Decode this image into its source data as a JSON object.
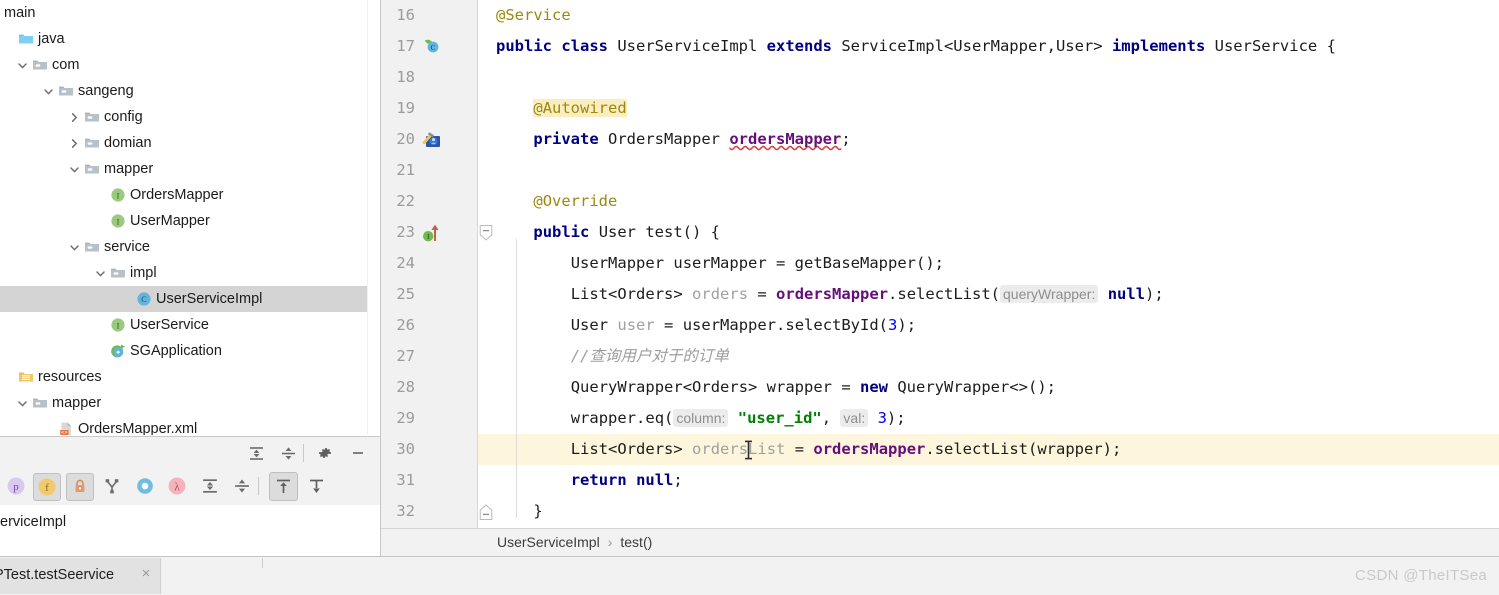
{
  "project_tree": {
    "rows": [
      {
        "label": "main",
        "indent": -14,
        "twisty": "",
        "icon": "none",
        "selected": false
      },
      {
        "label": "java",
        "indent": 0,
        "twisty": "",
        "icon": "source-folder-blue",
        "selected": false
      },
      {
        "label": "com",
        "indent": 14,
        "twisty": "down",
        "icon": "folder",
        "selected": false
      },
      {
        "label": "sangeng",
        "indent": 40,
        "twisty": "down",
        "icon": "folder",
        "selected": false
      },
      {
        "label": "config",
        "indent": 66,
        "twisty": "right",
        "icon": "folder",
        "selected": false
      },
      {
        "label": "domian",
        "indent": 66,
        "twisty": "right",
        "icon": "folder",
        "selected": false
      },
      {
        "label": "mapper",
        "indent": 66,
        "twisty": "down",
        "icon": "folder",
        "selected": false
      },
      {
        "label": "OrdersMapper",
        "indent": 92,
        "twisty": "",
        "icon": "interface",
        "selected": false
      },
      {
        "label": "UserMapper",
        "indent": 92,
        "twisty": "",
        "icon": "interface",
        "selected": false
      },
      {
        "label": "service",
        "indent": 66,
        "twisty": "down",
        "icon": "folder",
        "selected": false
      },
      {
        "label": "impl",
        "indent": 92,
        "twisty": "down",
        "icon": "folder",
        "selected": false
      },
      {
        "label": "UserServiceImpl",
        "indent": 118,
        "twisty": "",
        "icon": "class",
        "selected": true
      },
      {
        "label": "UserService",
        "indent": 92,
        "twisty": "",
        "icon": "interface",
        "selected": false
      },
      {
        "label": "SGApplication",
        "indent": 92,
        "twisty": "",
        "icon": "spring-boot-app",
        "selected": false
      },
      {
        "label": "resources",
        "indent": 0,
        "twisty": "",
        "icon": "resources-folder",
        "selected": false
      },
      {
        "label": "mapper",
        "indent": 14,
        "twisty": "down",
        "icon": "folder",
        "selected": false
      },
      {
        "label": "OrdersMapper.xml",
        "indent": 40,
        "twisty": "",
        "icon": "xml-file",
        "selected": false
      }
    ]
  },
  "panel_toolbar_top": {
    "buttons": [
      {
        "name": "expand-all-icon",
        "title": "Expand All"
      },
      {
        "name": "collapse-all-icon",
        "title": "Collapse All"
      },
      {
        "name": "gear-icon",
        "title": "Settings"
      },
      {
        "name": "minimize-icon",
        "title": "Hide"
      }
    ]
  },
  "panel_toolbar_filters": {
    "buttons": [
      {
        "name": "filter-package-private-icon",
        "letter": "p",
        "color": "#d7c6ef",
        "textcolor": "#6a4ca8",
        "active": false
      },
      {
        "name": "filter-fields-icon",
        "letter": "f",
        "color": "#f2c96b",
        "textcolor": "#8a6a16",
        "active": true
      },
      {
        "name": "filter-private-lock-icon",
        "letter": "lock",
        "color": "#e39a6b",
        "textcolor": "#a8541b",
        "active": true
      },
      {
        "name": "show-hierarchy-icon",
        "letter": "",
        "color": "#777777",
        "textcolor": "#777777",
        "active": false
      },
      {
        "name": "filter-non-null-icon",
        "letter": "O",
        "color": "#72bce0",
        "textcolor": "#72bce0",
        "active": false
      },
      {
        "name": "filter-lambda-icon",
        "letter": "λ",
        "color": "#f2b3bd",
        "textcolor": "#b84b62",
        "active": false
      },
      {
        "name": "expand-all-icon",
        "letter": "",
        "color": "#6b6b6b",
        "textcolor": "#6b6b6b",
        "active": false
      },
      {
        "name": "collapse-all-icon",
        "letter": "",
        "color": "#6b6b6b",
        "textcolor": "#6b6b6b",
        "active": false
      },
      {
        "name": "scroll-from-source-icon",
        "letter": "",
        "color": "#6b6b6b",
        "textcolor": "#6b6b6b",
        "active": true
      },
      {
        "name": "scroll-to-source-icon",
        "letter": "",
        "color": "#6b6b6b",
        "textcolor": "#6b6b6b",
        "active": false
      }
    ]
  },
  "run_output": {
    "text": "erviceImpl"
  },
  "bottom_bar": {
    "tab_label": "PTest.testSeervice",
    "tab_close": "×",
    "watermark": "CSDN @TheITSea"
  },
  "breadcrumb": {
    "class": "UserServiceImpl",
    "separator": "›",
    "method": "test()"
  },
  "editor": {
    "first_line": 16,
    "highlighted_line": 30,
    "lines": [
      {
        "n": 16,
        "gutter": "none",
        "fold": "none"
      },
      {
        "n": 17,
        "gutter": "class-bean-icon",
        "fold": "none"
      },
      {
        "n": 18,
        "gutter": "none",
        "fold": "none"
      },
      {
        "n": 19,
        "gutter": "none",
        "fold": "none"
      },
      {
        "n": 20,
        "gutter": "autowired-bean-icon",
        "fold": "none"
      },
      {
        "n": 21,
        "gutter": "none",
        "fold": "none"
      },
      {
        "n": 22,
        "gutter": "none",
        "fold": "none"
      },
      {
        "n": 23,
        "gutter": "implementing-method-icon",
        "fold": "collapse-top"
      },
      {
        "n": 24,
        "gutter": "none",
        "fold": "none"
      },
      {
        "n": 25,
        "gutter": "none",
        "fold": "none"
      },
      {
        "n": 26,
        "gutter": "none",
        "fold": "none"
      },
      {
        "n": 27,
        "gutter": "none",
        "fold": "none"
      },
      {
        "n": 28,
        "gutter": "none",
        "fold": "none"
      },
      {
        "n": 29,
        "gutter": "none",
        "fold": "none"
      },
      {
        "n": 30,
        "gutter": "none",
        "fold": "none"
      },
      {
        "n": 31,
        "gutter": "none",
        "fold": "none"
      },
      {
        "n": 32,
        "gutter": "none",
        "fold": "collapse-bottom"
      }
    ],
    "code": {
      "l16": "@Service",
      "l17": "public class UserServiceImpl extends ServiceImpl<UserMapper,User> implements UserService {",
      "l19": "@Autowired",
      "l20": "private OrdersMapper ordersMapper;",
      "l22": "@Override",
      "l23": "public User test() {",
      "l24": "UserMapper userMapper = getBaseMapper();",
      "l25": "List<Orders> orders = ordersMapper.selectList( queryWrapper: null);",
      "l26": "User user = userMapper.selectById(3);",
      "l27": "//查询用户对于的订单",
      "l28": "QueryWrapper<Orders> wrapper = new QueryWrapper<>();",
      "l29": "wrapper.eq( column: \"user_id\", val: 3);",
      "l30": "List<Orders> ordersList = ordersMapper.selectList(wrapper);",
      "l31": "return null;",
      "l32": "}"
    },
    "tokens": {
      "kw_public": "public",
      "kw_class": "class",
      "kw_extends": "extends",
      "kw_implements": "implements",
      "kw_private": "private",
      "kw_new": "new",
      "kw_return": "return",
      "kw_null": "null",
      "hint_queryWrapper": "queryWrapper:",
      "hint_column": "column:",
      "hint_val": "val:",
      "str_user_id": "\"user_id\"",
      "num_3": "3"
    }
  },
  "colors": {
    "keyword": "#000080",
    "annotation": "#9e880d",
    "annotation_highlight_bg": "#faeec0",
    "field": "#660e7a",
    "string": "#008000",
    "number": "#0000ff",
    "comment": "#9d9d9d",
    "local_var": "#a0a0a0",
    "hint_bg": "#ececec",
    "line_highlight": "#fdf6dd",
    "selection": "#d4d4d4",
    "gutter_bg": "#f1f1f1",
    "panel_bg": "#f2f2f2",
    "watermark": "#c9c9c9"
  }
}
